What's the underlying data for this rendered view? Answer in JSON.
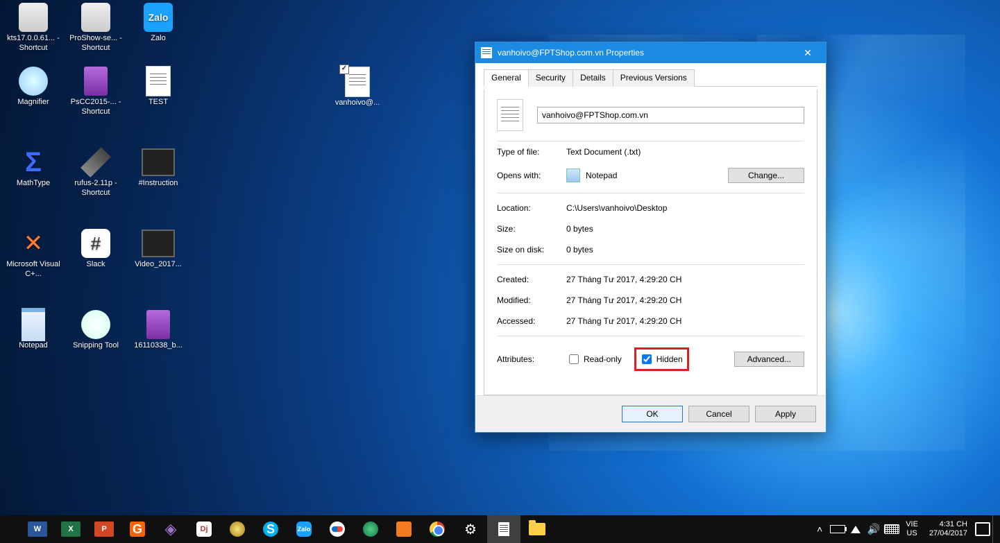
{
  "desktop_icons": {
    "r1": [
      "kts17.0.0.61... - Shortcut",
      "ProShow-se... - Shortcut",
      "Zalo"
    ],
    "r2": [
      "Magnifier",
      "PsCC2015-... - Shortcut",
      "TEST"
    ],
    "r3": [
      "MathType",
      "rufus-2.11p - Shortcut",
      "#Instruction"
    ],
    "r4": [
      "Microsoft Visual C+...",
      "Slack",
      "Video_2017..."
    ],
    "r5": [
      "Notepad",
      "Snipping Tool",
      "16110338_b..."
    ]
  },
  "free_icon": {
    "label": "vanhoivo@...",
    "checked": true
  },
  "dialog": {
    "title": "vanhoivo@FPTShop.com.vn Properties",
    "tabs": [
      "General",
      "Security",
      "Details",
      "Previous Versions"
    ],
    "filename": "vanhoivo@FPTShop.com.vn",
    "type_label": "Type of file:",
    "type_value": "Text Document (.txt)",
    "opens_label": "Opens with:",
    "opens_value": "Notepad",
    "change": "Change...",
    "location_label": "Location:",
    "location_value": "C:\\Users\\vanhoivo\\Desktop",
    "size_label": "Size:",
    "size_value": "0 bytes",
    "sizeondisk_label": "Size on disk:",
    "sizeondisk_value": "0 bytes",
    "created_label": "Created:",
    "created_value": "27 Tháng Tư 2017, 4:29:20 CH",
    "modified_label": "Modified:",
    "modified_value": "27 Tháng Tư 2017, 4:29:20 CH",
    "accessed_label": "Accessed:",
    "accessed_value": "27 Tháng Tư 2017, 4:29:20 CH",
    "attributes_label": "Attributes:",
    "readonly": "Read-only",
    "hidden": "Hidden",
    "advanced": "Advanced...",
    "ok": "OK",
    "cancel": "Cancel",
    "apply": "Apply"
  },
  "taskbar": {
    "lang1": "VIE",
    "lang2": "US",
    "time": "4:31 CH",
    "date": "27/04/2017"
  }
}
